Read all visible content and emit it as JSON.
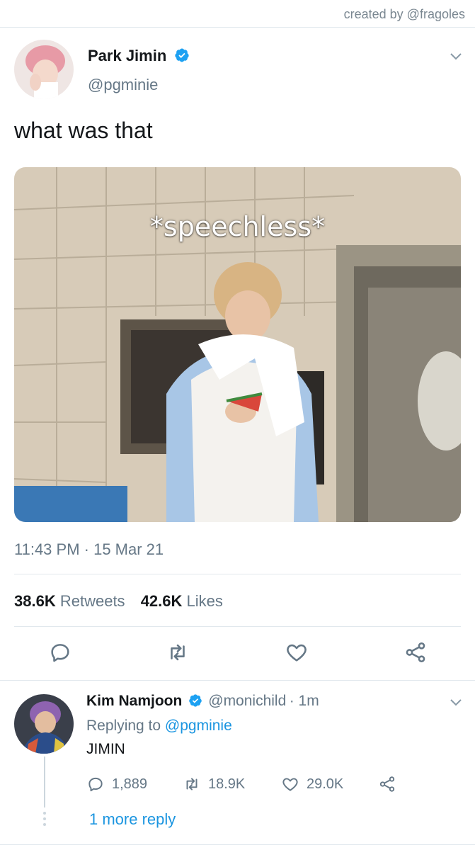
{
  "credit": "created by @fragoles",
  "tweet": {
    "name": "Park Jimin",
    "handle": "@pgminie",
    "text": "what was that",
    "media_caption": "*speechless*",
    "timestamp": "11:43 PM · 15 Mar 21",
    "retweets_count": "38.6K",
    "retweets_label": "Retweets",
    "likes_count": "42.6K",
    "likes_label": "Likes"
  },
  "reply": {
    "name": "Kim Namjoon",
    "handle": "@monichild",
    "time": "· 1m",
    "replying_prefix": "Replying to",
    "replying_to": "@pgminie",
    "text": "JIMIN",
    "reply_count": "1,889",
    "retweet_count": "18.9K",
    "like_count": "29.0K",
    "more_replies": "1 more reply"
  },
  "icons": {
    "verified": "verified-badge-icon",
    "chevron": "chevron-down-icon",
    "reply": "reply-icon",
    "retweet": "retweet-icon",
    "like": "heart-icon",
    "share": "share-icon"
  },
  "colors": {
    "accent": "#1da1f2",
    "link": "#1b95e0",
    "text": "#14171a",
    "muted": "#657786"
  }
}
